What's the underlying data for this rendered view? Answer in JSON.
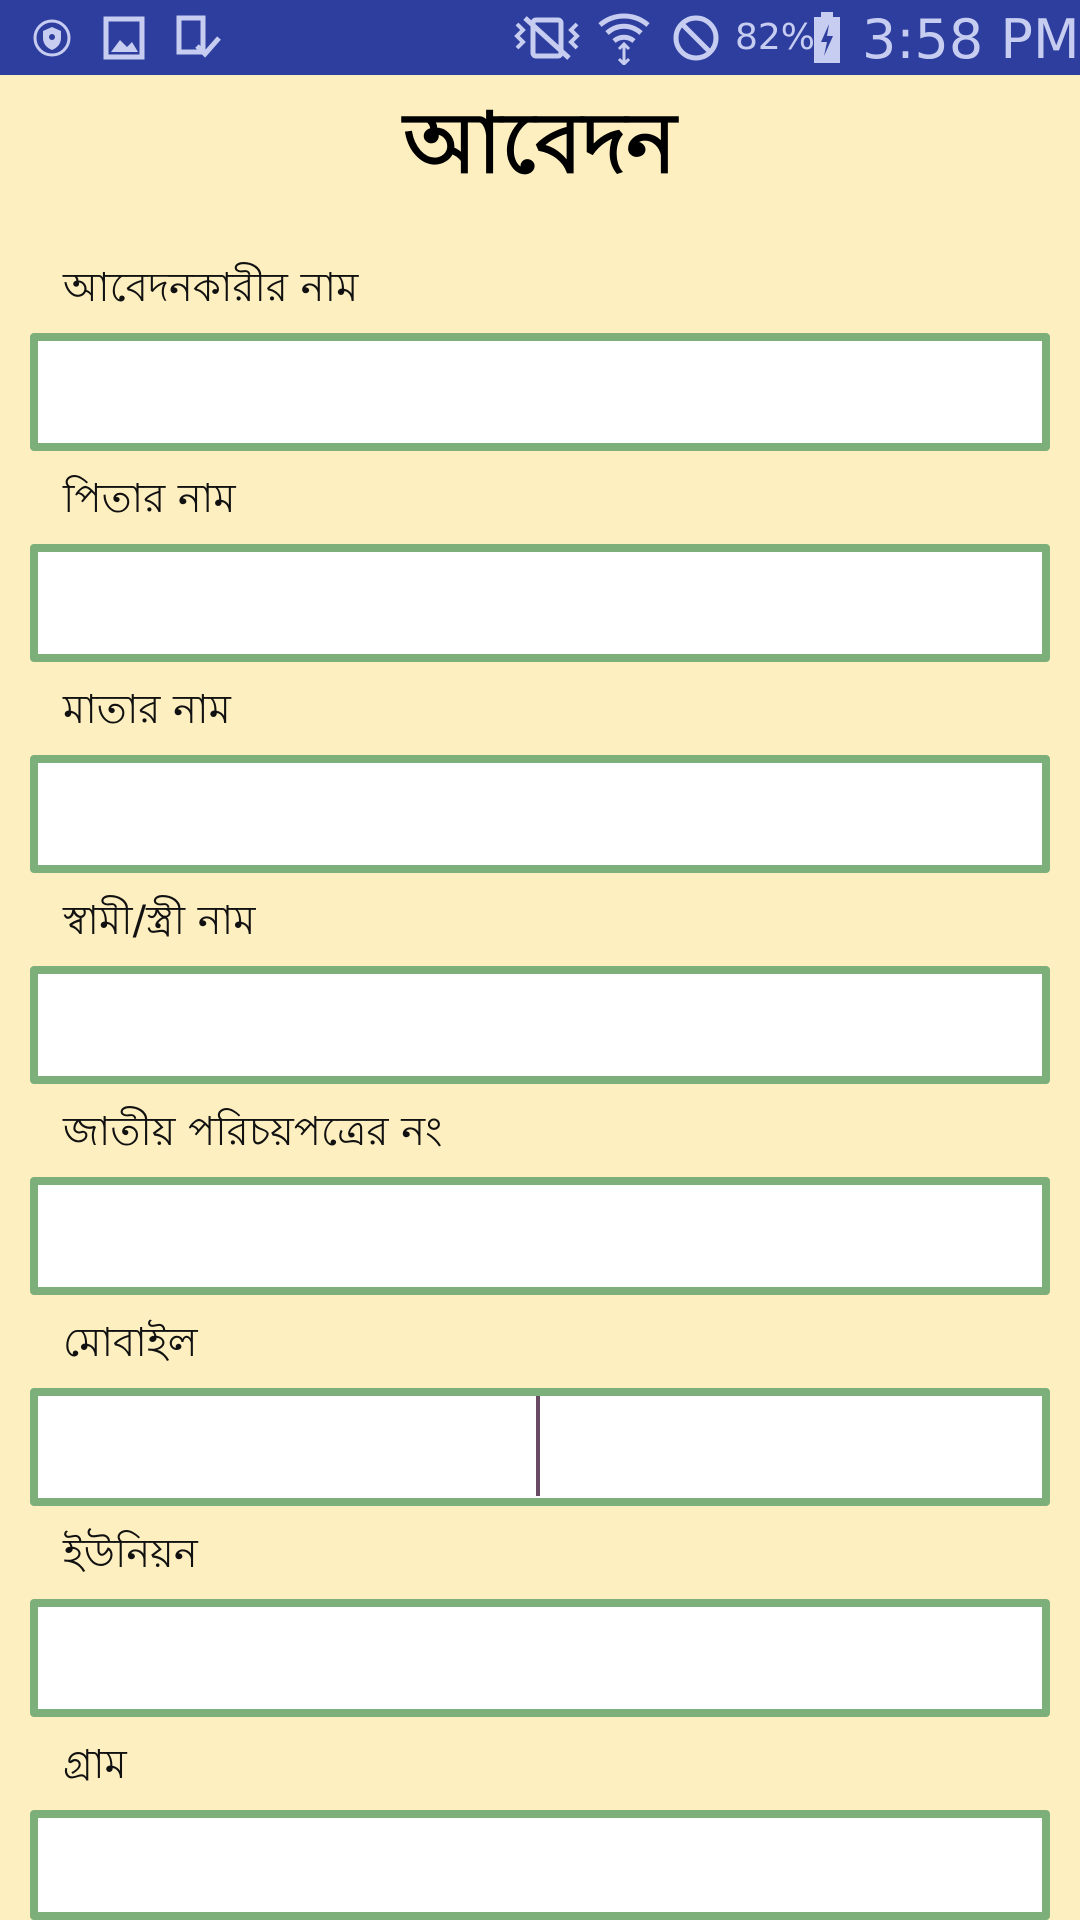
{
  "status_bar": {
    "icons_left": [
      "shield-icon",
      "image-icon",
      "screenshot-icon"
    ],
    "icons_right": [
      "vibrate-icon",
      "wifi-icon",
      "do-not-disturb-icon",
      "battery-charging-icon"
    ],
    "battery_percent": "82%",
    "time": "3:58 PM",
    "colors": {
      "background": "#2e3e9e",
      "foreground": "#c7cdf0"
    }
  },
  "form": {
    "title": "আবেদন",
    "fields": [
      {
        "label": "আবেদনকারীর নাম",
        "value": "",
        "placeholder": ""
      },
      {
        "label": "পিতার নাম",
        "value": "",
        "placeholder": ""
      },
      {
        "label": "মাতার নাম",
        "value": "",
        "placeholder": ""
      },
      {
        "label": "স্বামী/স্ত্রী নাম",
        "value": "",
        "placeholder": ""
      },
      {
        "label": "জাতীয় পরিচয়পত্রের নং",
        "value": "",
        "placeholder": ""
      },
      {
        "label": "মোবাইল",
        "value": "",
        "placeholder": "",
        "focused": true
      },
      {
        "label": "ইউনিয়ন",
        "value": "",
        "placeholder": ""
      },
      {
        "label": "গ্রাম",
        "value": "",
        "placeholder": ""
      }
    ]
  },
  "colors": {
    "page_background": "#fdefbf",
    "input_border": "#7daf7a",
    "input_background": "#ffffff",
    "caret": "#6a4a63"
  }
}
